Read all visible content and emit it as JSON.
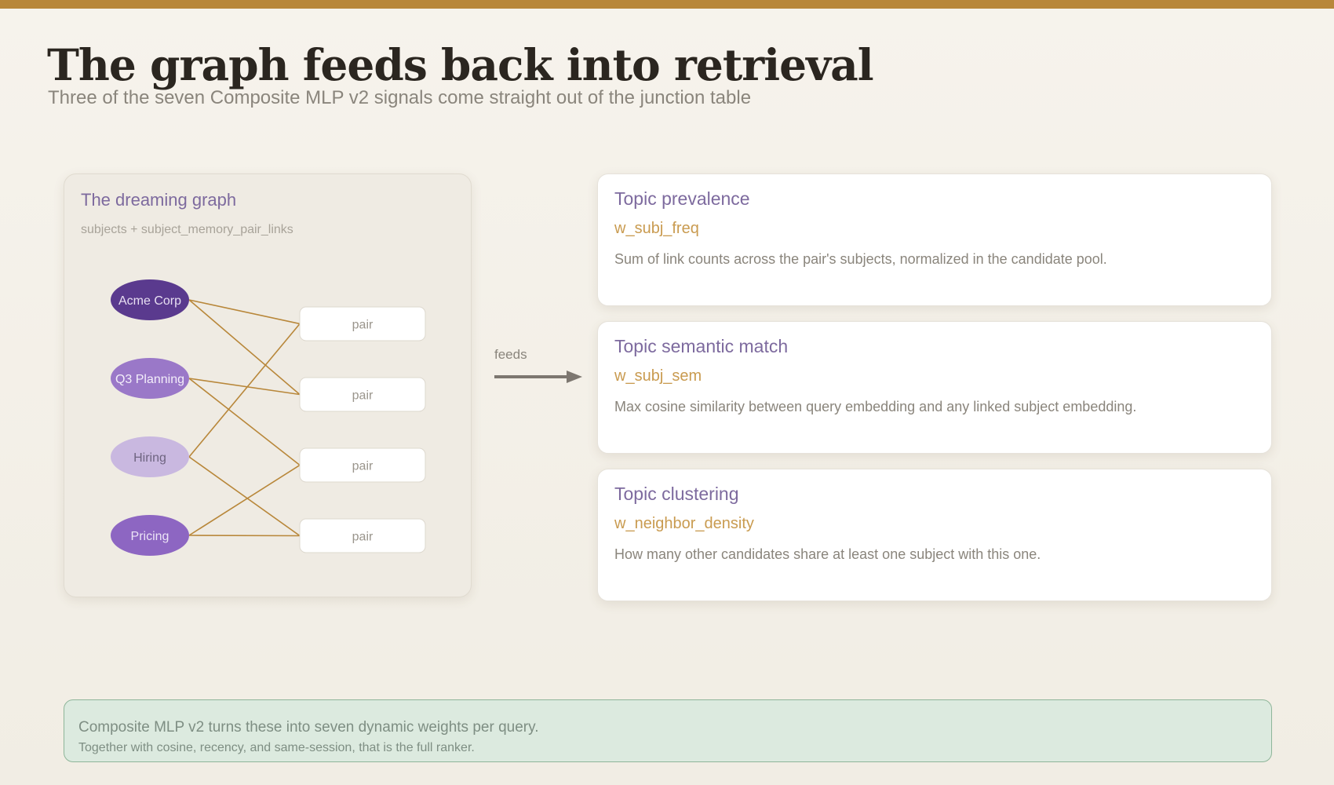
{
  "header": {
    "title": "The graph feeds back into retrieval",
    "subtitle": "Three of the seven Composite MLP v2 signals come straight out of the junction table"
  },
  "graph_panel": {
    "title": "The dreaming graph",
    "subtitle": "subjects + subject_memory_pair_links",
    "subjects": [
      {
        "label": "Acme Corp",
        "color": "#5a3a8e",
        "text_color": "#e8e0f2"
      },
      {
        "label": "Q3 Planning",
        "color": "#9a78c8",
        "text_color": "#f3eefa"
      },
      {
        "label": "Hiring",
        "color": "#c9b8e0",
        "text_color": "#6e6480"
      },
      {
        "label": "Pricing",
        "color": "#8d66c2",
        "text_color": "#ece4f6"
      }
    ],
    "pairs": [
      {
        "label": "pair"
      },
      {
        "label": "pair"
      },
      {
        "label": "pair"
      },
      {
        "label": "pair"
      }
    ],
    "links": [
      [
        0,
        0
      ],
      [
        0,
        1
      ],
      [
        1,
        1
      ],
      [
        1,
        2
      ],
      [
        2,
        0
      ],
      [
        2,
        3
      ],
      [
        3,
        2
      ],
      [
        3,
        3
      ]
    ],
    "link_color": "#b8873a"
  },
  "flow": {
    "label": "feeds"
  },
  "signals": [
    {
      "name": "Topic prevalence",
      "weight": "w_subj_freq",
      "description": "Sum of link counts across the pair's subjects, normalized in the candidate pool."
    },
    {
      "name": "Topic semantic match",
      "weight": "w_subj_sem",
      "description": "Max cosine similarity between query embedding and any linked subject embedding."
    },
    {
      "name": "Topic clustering",
      "weight": "w_neighbor_density",
      "description": "How many other candidates share at least one subject with this one."
    }
  ],
  "footer": {
    "line1": "Composite MLP v2 turns these into seven dynamic weights per query.",
    "line2": "Together with cosine, recency, and same-session, that is the full ranker."
  },
  "colors": {
    "accent_bar": "#b8873a",
    "footer_bg": "#dceadf",
    "footer_border": "#8eb599"
  }
}
